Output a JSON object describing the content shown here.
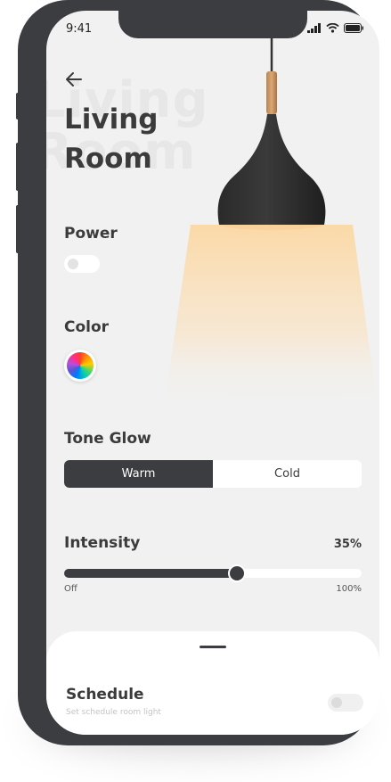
{
  "status": {
    "time": "9:41"
  },
  "header": {
    "title_line1": "Living",
    "title_line2": "Room",
    "bg_title_line1": "Living",
    "bg_title_line2": "Room"
  },
  "power": {
    "label": "Power",
    "on": false
  },
  "color": {
    "label": "Color"
  },
  "tone": {
    "label": "Tone Glow",
    "options": [
      "Warm",
      "Cold"
    ],
    "selected": "Warm"
  },
  "intensity": {
    "label": "Intensity",
    "value_text": "35%",
    "value_fraction": 0.58,
    "min_label": "Off",
    "max_label": "100%"
  },
  "schedule": {
    "title": "Schedule",
    "subtitle": "Set schedule room light",
    "on": false
  },
  "colors": {
    "dark": "#3b3d41",
    "background": "#f1f1f1",
    "glow": "#fbd9a7"
  }
}
